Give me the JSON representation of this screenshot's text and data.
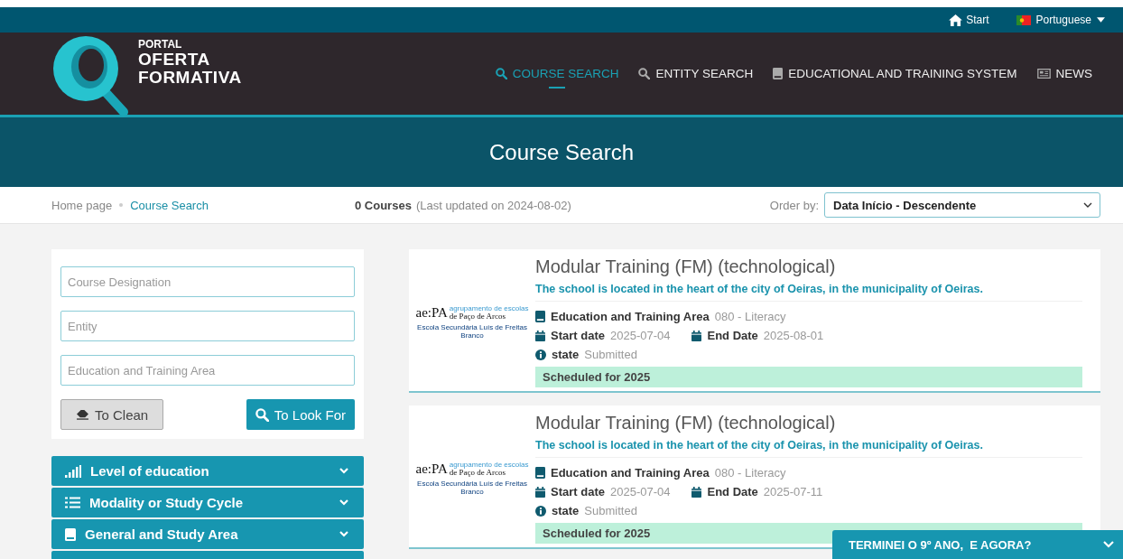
{
  "topbar": {
    "home": "Start",
    "language": "Portuguese"
  },
  "logo": {
    "line1": "PORTAL",
    "line2": "OFERTA",
    "line3": "FORMATIVA"
  },
  "nav": [
    {
      "label": "COURSE SEARCH",
      "kind": "search",
      "selected": true
    },
    {
      "label": "ENTITY SEARCH",
      "kind": "search",
      "selected": false
    },
    {
      "label": "EDUCATIONAL AND TRAINING SYSTEM",
      "kind": "book",
      "selected": false
    },
    {
      "label": "NEWS",
      "kind": "news",
      "selected": false
    }
  ],
  "banner": {
    "title": "Course Search"
  },
  "breadcrumb": [
    "Home page",
    "Course Search"
  ],
  "results": {
    "count": "0 Courses",
    "updated": "(Last updated on 2024-08-02)"
  },
  "order": {
    "label": "Order by:",
    "value": "Data Início - Descendente"
  },
  "filters": {
    "fields": [
      {
        "placeholder": "Course Designation"
      },
      {
        "placeholder": "Entity"
      },
      {
        "placeholder": "Education and Training Area"
      }
    ],
    "clear": "To Clean",
    "search": "To Look For"
  },
  "accordion": [
    {
      "label": "Level of education",
      "kind": "bars"
    },
    {
      "label": "Modality or Study Cycle",
      "kind": "list"
    },
    {
      "label": "General and Study Area",
      "kind": "book"
    }
  ],
  "courses": [
    {
      "title": "Modular Training (FM) (technological)",
      "description": "The school is located in the heart of the city of Oeiras, in the municipality of Oeiras.",
      "logo": {
        "mark": "ae:PA",
        "small": "agrupamento de escolas",
        "place": "de Paço de Arcos",
        "school": "Escola Secundária Luís de Freitas Branco"
      },
      "area_label": "Education and Training Area",
      "area": "080 - Literacy",
      "start_label": "Start date",
      "start": "2025-07-04",
      "end_label": "End Date",
      "end": "2025-08-01",
      "state_label": "state",
      "state": "Submitted",
      "schedule": "Scheduled for 2025"
    },
    {
      "title": "Modular Training (FM) (technological)",
      "description": "The school is located in the heart of the city of Oeiras, in the municipality of Oeiras.",
      "logo": {
        "mark": "ae:PA",
        "small": "agrupamento de escolas",
        "place": "de Paço de Arcos",
        "school": "Escola Secundária Luís de Freitas Branco"
      },
      "area_label": "Education and Training Area",
      "area": "080 - Literacy",
      "start_label": "Start date",
      "start": "2025-07-04",
      "end_label": "End Date",
      "end": "2025-07-11",
      "state_label": "state",
      "state": "Submitted",
      "schedule": "Scheduled for 2025"
    }
  ],
  "help_bar": {
    "label": "TERMINEI O 9º ANO,  E AGORA?"
  }
}
